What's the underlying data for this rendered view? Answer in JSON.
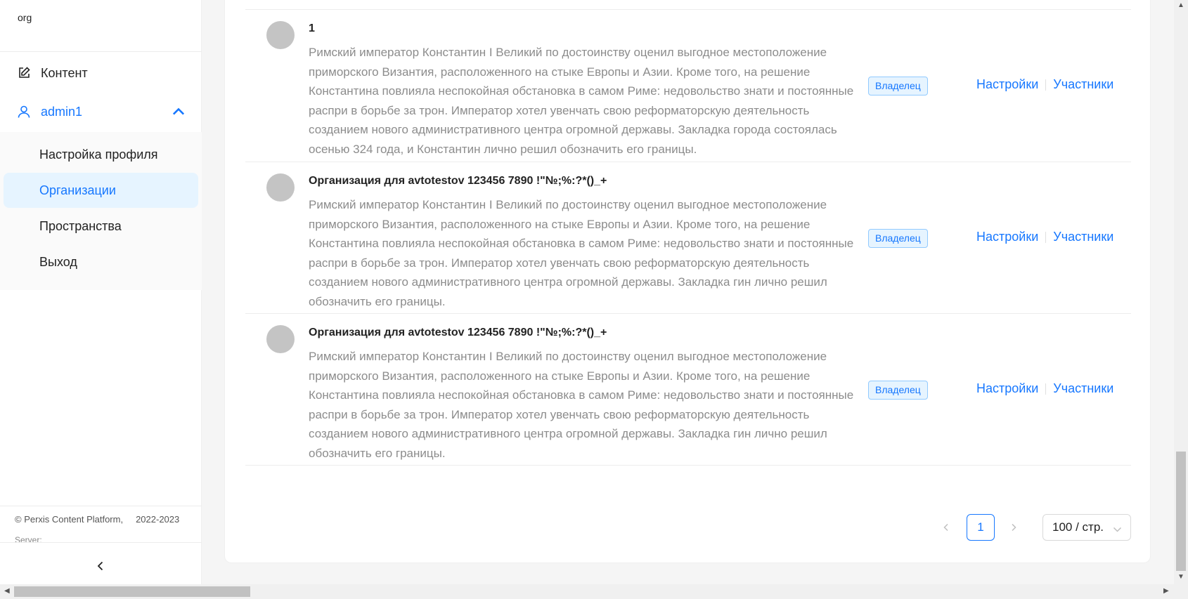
{
  "sidebar": {
    "org": "org",
    "menu": {
      "content": "Контент",
      "user": "admin1"
    },
    "submenu": [
      {
        "label": "Настройка профиля"
      },
      {
        "label": "Организации"
      },
      {
        "label": "Пространства"
      },
      {
        "label": "Выход"
      }
    ],
    "footer": {
      "copyright": "© Perxis Content Platform,",
      "years": "2022-2023",
      "server": "Server:"
    }
  },
  "orgs": [
    {
      "title": "1",
      "description": "Римский император Константин I Великий по достоинству оценил выгодное местоположение приморского Византия, расположенного на стыке Европы и Азии. Кроме того, на решение Константина повлияла неспокойная обстановка в самом Риме: недовольство знати и постоянные распри в борьбе за трон. Император хотел увенчать свою реформаторскую деятельность созданием нового административного центра огромной державы. Закладка города состоялась осенью 324 года, и Константин лично решил обозначить его границы.",
      "badge": "Владелец",
      "settings": "Настройки",
      "members": "Участники"
    },
    {
      "title": "Организация для avtotestov 123456 7890 !\"№;%:?*()_+",
      "description": "Римский император Константин I Великий по достоинству оценил выгодное местоположение приморского Византия, расположенного на стыке Европы и Азии. Кроме того, на решение Константина повлияла неспокойная обстановка в самом Риме: недовольство знати и постоянные распри в борьбе за трон. Император хотел увенчать свою реформаторскую деятельность созданием нового административного центра огромной державы. Закладка гин лично решил обозначить его границы.",
      "badge": "Владелец",
      "settings": "Настройки",
      "members": "Участники"
    },
    {
      "title": "Организация для avtotestov 123456 7890 !\"№;%:?*()_+",
      "description": "Римский император Константин I Великий по достоинству оценил выгодное местоположение приморского Византия, расположенного на стыке Европы и Азии. Кроме того, на решение Константина повлияла неспокойная обстановка в самом Риме: недовольство знати и постоянные распри в борьбе за трон. Император хотел увенчать свою реформаторскую деятельность созданием нового административного центра огромной державы. Закладка гин лично решил обозначить его границы.",
      "badge": "Владелец",
      "settings": "Настройки",
      "members": "Участники"
    }
  ],
  "pagination": {
    "current": "1",
    "page_size": "100 / стр."
  },
  "colors": {
    "accent": "#1677ff",
    "accent_bg": "#e6f4ff",
    "text_muted": "#8c8c8c"
  }
}
